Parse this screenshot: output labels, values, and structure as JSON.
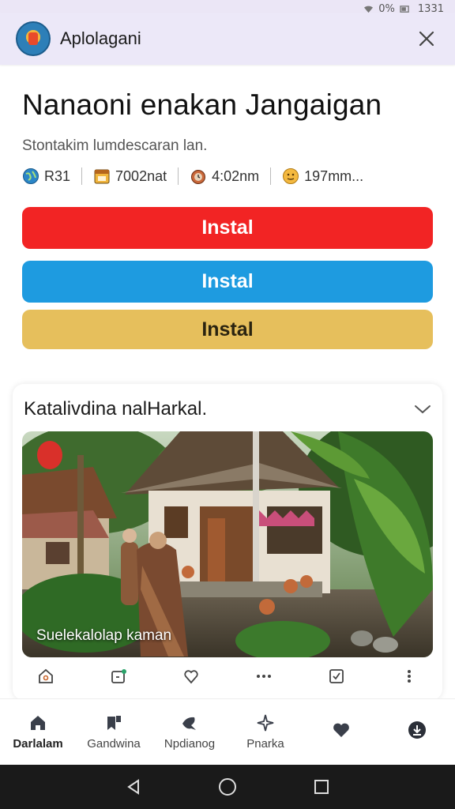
{
  "status_bar": {
    "battery": "0%",
    "time": "1331"
  },
  "app_bar": {
    "title": "Aplolagani"
  },
  "page": {
    "title": "Nanaoni enakan Jangaigan",
    "subtitle": "Stontakim lumdescaran lan."
  },
  "meta": [
    {
      "icon": "globe-icon",
      "text": "R31"
    },
    {
      "icon": "calendar-icon",
      "text": "7002nat"
    },
    {
      "icon": "clock-icon",
      "text": "4:02nm"
    },
    {
      "icon": "face-icon",
      "text": "197mm..."
    }
  ],
  "buttons": {
    "install_red": "Instal",
    "install_blue": "Instal",
    "install_gold": "Instal"
  },
  "card": {
    "title": "Katalivdina nalHarkal.",
    "photo_caption": "Suelekalolap kaman"
  },
  "action_icons": [
    "home-outline-icon",
    "tag-icon",
    "heart-outline-icon",
    "more-horizontal-icon",
    "checkbox-icon",
    "more-vertical-icon"
  ],
  "bottom_nav": [
    {
      "icon": "home-icon",
      "label": "Darlalam"
    },
    {
      "icon": "bookmark-icon",
      "label": "Gandwina"
    },
    {
      "icon": "feather-icon",
      "label": "Npdianog"
    },
    {
      "icon": "sparkle-icon",
      "label": "Pnarka"
    },
    {
      "icon": "heart-icon",
      "label": ""
    },
    {
      "icon": "download-icon",
      "label": ""
    }
  ],
  "colors": {
    "app_bar_bg": "#ece8f8",
    "red": "#f22424",
    "blue": "#1e9be0",
    "gold": "#e6bf5c",
    "system_nav": "#1a1a1a"
  }
}
